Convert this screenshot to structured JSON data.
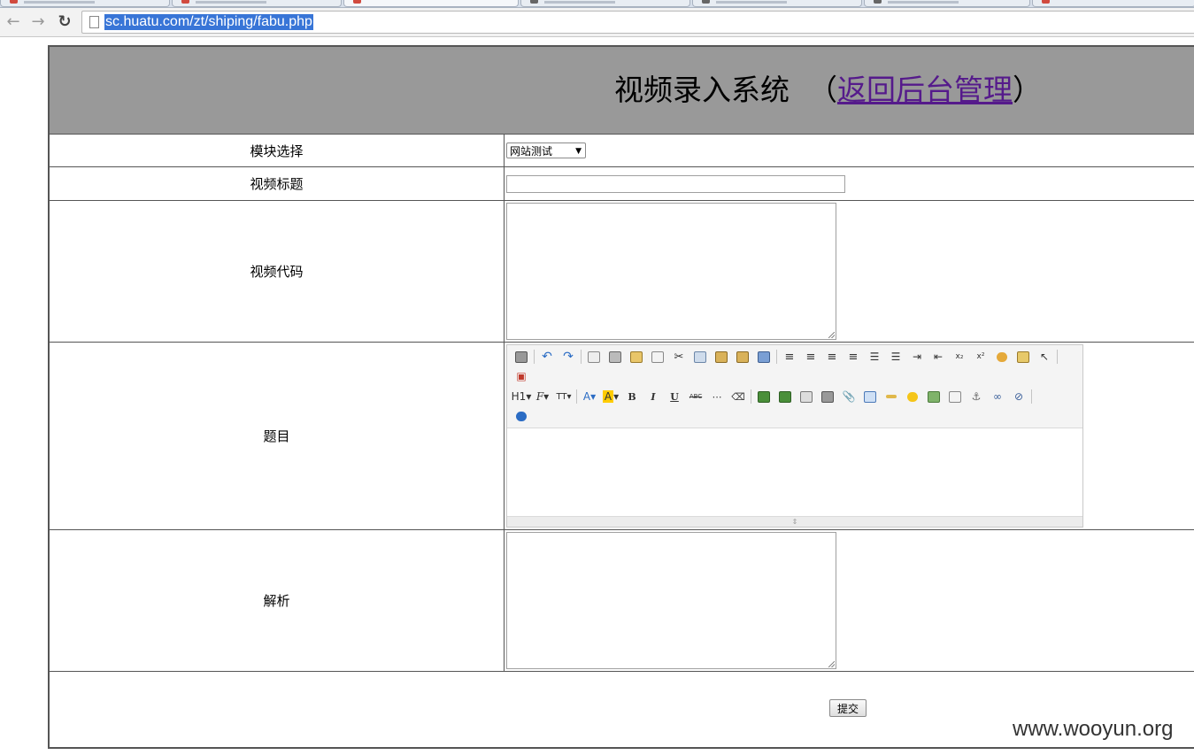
{
  "browser": {
    "url": "sc.huatu.com/zt/shiping/fabu.php",
    "back_icon": "arrow-left-icon",
    "forward_icon": "arrow-right-icon",
    "reload_icon": "reload-icon"
  },
  "header": {
    "title": "视频录入系统",
    "open_paren": "（",
    "link_text": "返回后台管理",
    "close_paren": "）"
  },
  "form": {
    "module_label": "模块选择",
    "module_selected": "网站测试",
    "video_title_label": "视频标题",
    "video_code_label": "视频代码",
    "question_label": "题目",
    "analysis_label": "解析",
    "submit_label": "提交"
  },
  "editor_toolbar": {
    "heading_label": "H1",
    "font_label": "F",
    "size_label": "TT",
    "font_color_label": "A",
    "bg_color_label": "A",
    "bold_label": "B",
    "italic_label": "I",
    "underline_label": "U",
    "strike_label": "ABC"
  },
  "watermark": "www.wooyun.org"
}
